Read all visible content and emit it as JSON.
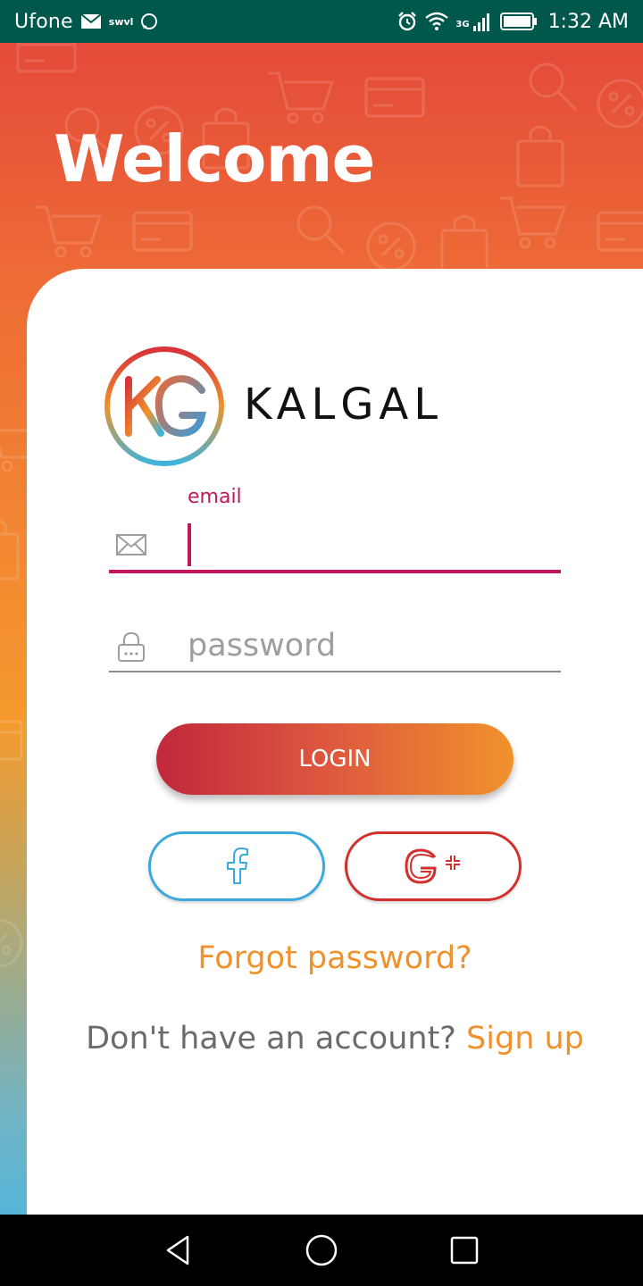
{
  "status_bar": {
    "carrier": "Ufone",
    "app_tag": "swvl",
    "network": "3G",
    "time": "1:32 AM"
  },
  "header": {
    "title": "Welcome"
  },
  "brand": {
    "logo_text": "KG",
    "name": "KALGAL"
  },
  "login_form": {
    "email_label": "email",
    "email_value": "",
    "email_icon": "envelope-icon",
    "password_placeholder": "password",
    "password_icon": "lock-icon",
    "login_label": "LOGIN"
  },
  "social": {
    "facebook_glyph": "f",
    "google_glyph": "G+"
  },
  "links": {
    "forgot_password": "Forgot password?",
    "no_account": "Don't have an account?",
    "sign_up": "Sign up"
  },
  "colors": {
    "accent": "#c2185b",
    "orange": "#f0922c",
    "status_bar": "#00574b",
    "facebook": "#3aa9dd",
    "google": "#d2302c"
  }
}
